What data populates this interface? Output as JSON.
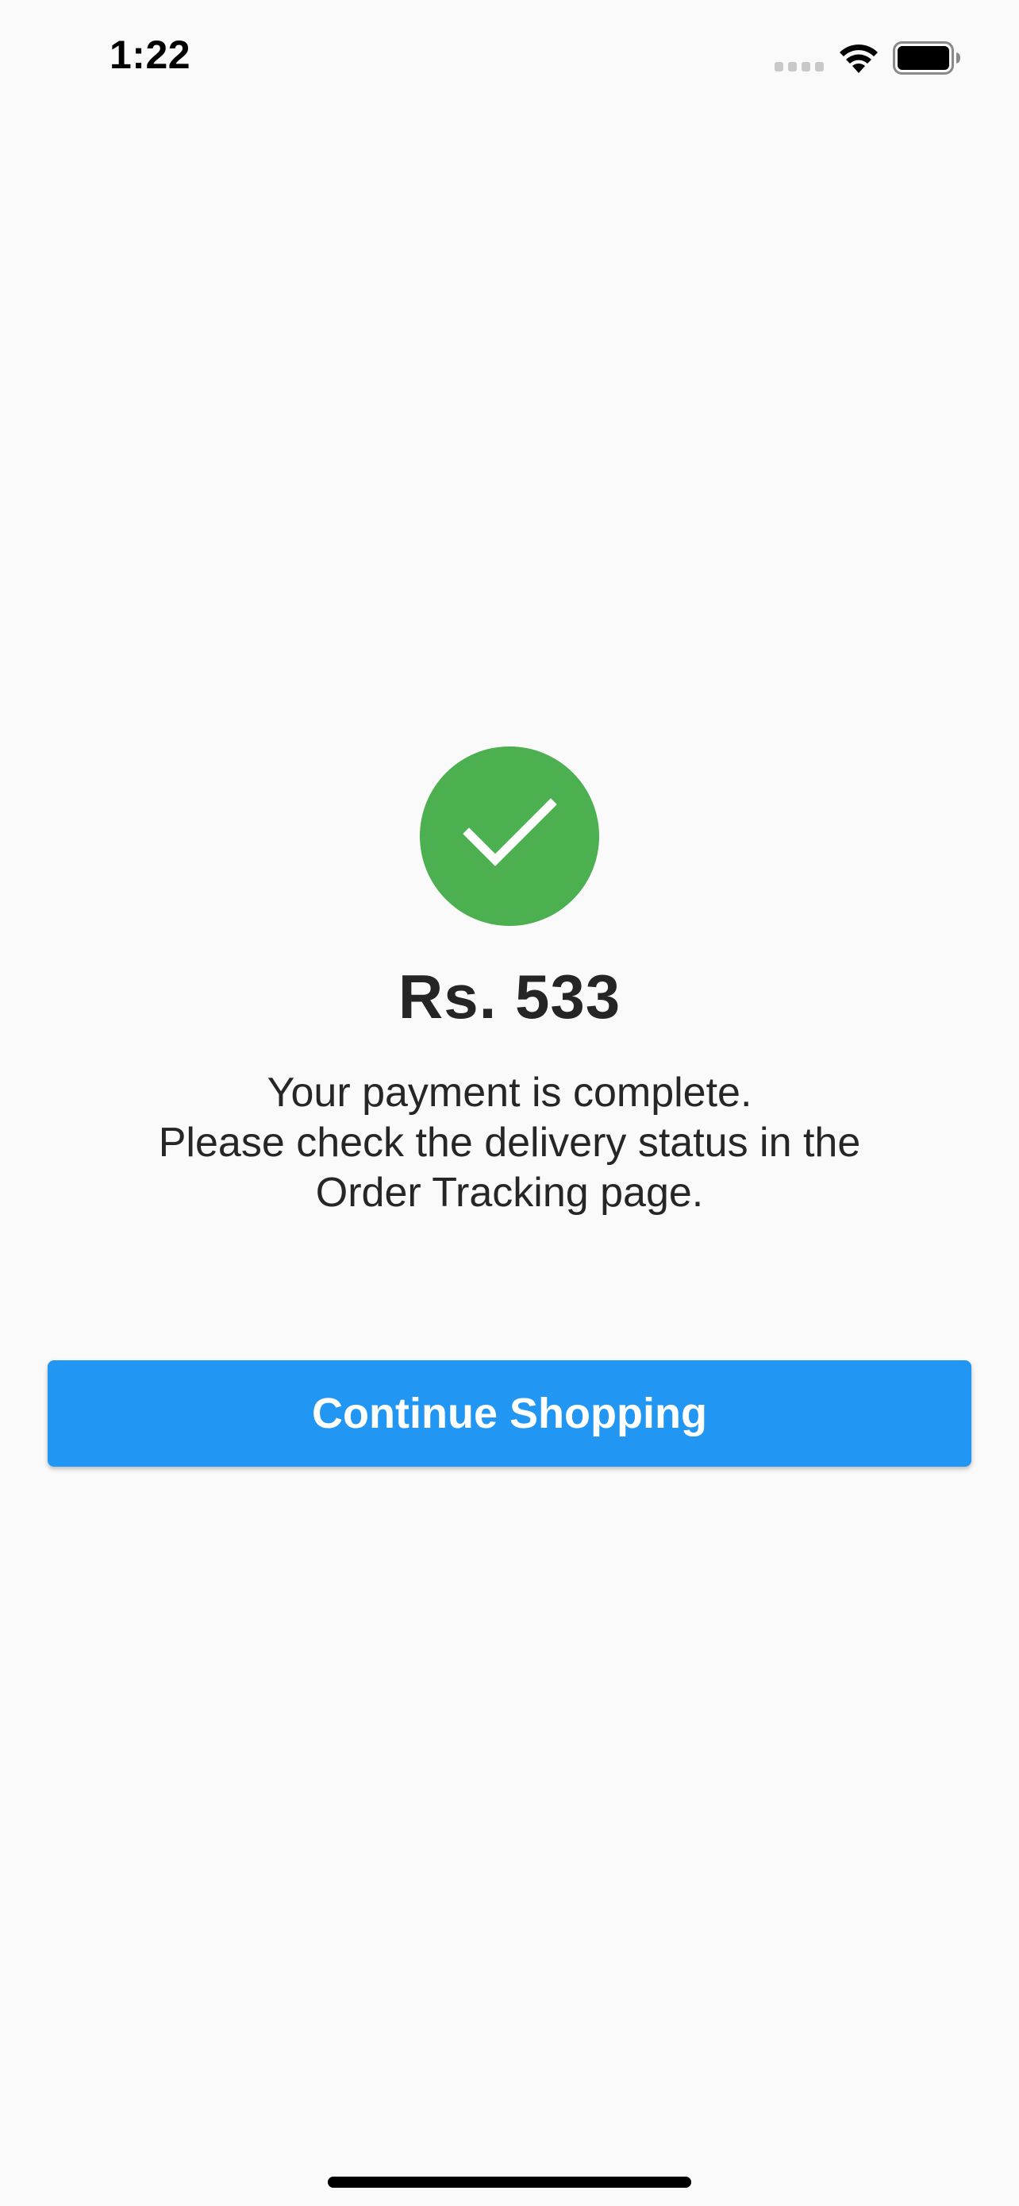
{
  "status_bar": {
    "time": "1:22",
    "icons": [
      "cellular-signal-icon",
      "wifi-icon",
      "battery-icon"
    ]
  },
  "payment_success": {
    "icon": "checkmark-icon",
    "icon_color": "#4caf50",
    "amount": "Rs. 533",
    "message_lines": [
      "Your payment is complete.",
      "Please check the delivery status in the",
      "Order Tracking page."
    ]
  },
  "actions": {
    "continue_label": "Continue Shopping",
    "button_color": "#2196f3"
  }
}
